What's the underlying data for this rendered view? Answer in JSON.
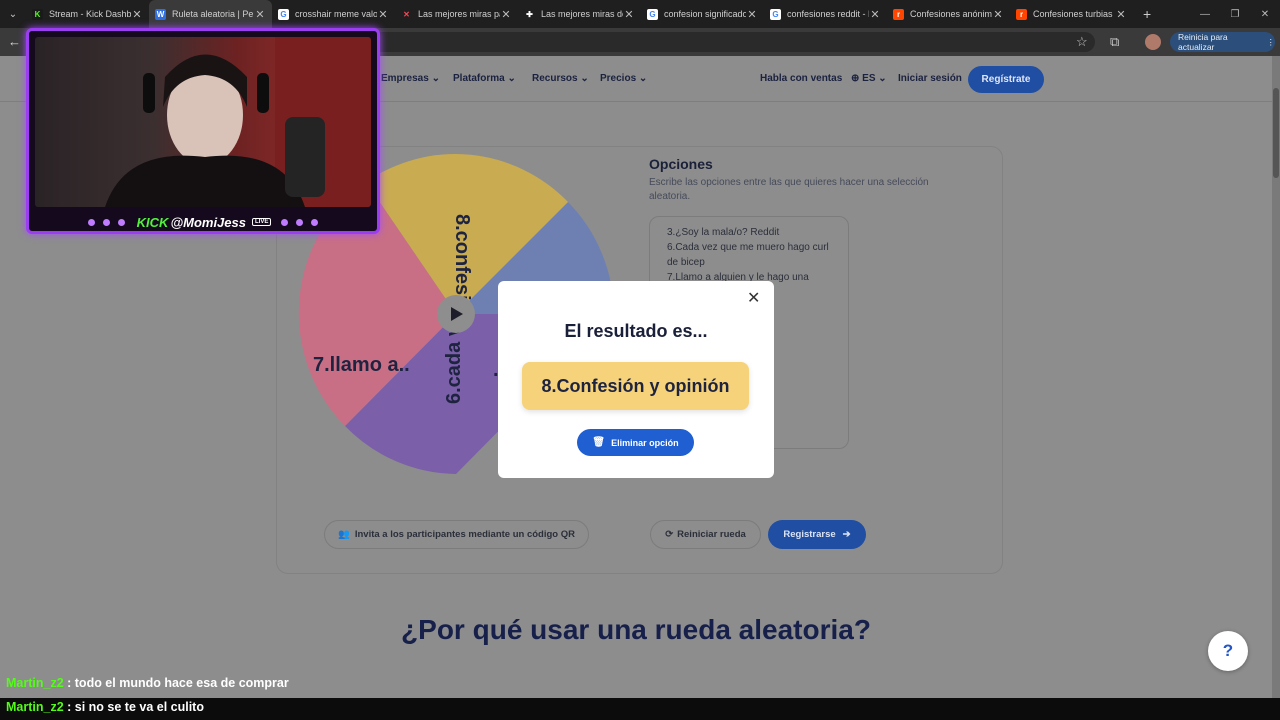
{
  "browser": {
    "tabs": [
      {
        "title": "Stream - Kick Dashbo",
        "fav": "K",
        "fav_bg": "#1a1a1a",
        "fav_color": "#53fc18"
      },
      {
        "title": "Ruleta aleatoria | Pers",
        "fav": "W",
        "fav_bg": "#2f6fe0",
        "fav_color": "#ffffff",
        "active": true
      },
      {
        "title": "crosshair meme valor",
        "fav": "G",
        "fav_bg": "#ffffff",
        "fav_color": "#4285f4"
      },
      {
        "title": "Las mejores miras pa",
        "fav": "✕",
        "fav_bg": "#1f1f1f",
        "fav_color": "#ff4655"
      },
      {
        "title": "Las mejores miras de",
        "fav": "✚",
        "fav_bg": "#1f1f1f",
        "fav_color": "#ffffff"
      },
      {
        "title": "confesion significado",
        "fav": "G",
        "fav_bg": "#ffffff",
        "fav_color": "#4285f4"
      },
      {
        "title": "confesiones reddit - E",
        "fav": "G",
        "fav_bg": "#ffffff",
        "fav_color": "#4285f4"
      },
      {
        "title": "Confesiones anónimas",
        "fav": "r",
        "fav_bg": "#ff4500",
        "fav_color": "#ffffff"
      },
      {
        "title": "Confesiones turbias",
        "fav": "r",
        "fav_bg": "#ff4500",
        "fav_color": "#ffffff"
      }
    ],
    "update_label": "Reinicia para actualizar"
  },
  "nav": {
    "items": [
      "Empresas",
      "Plataforma",
      "Recursos",
      "Precios"
    ],
    "sales": "Habla con ventas",
    "lang": "ES",
    "login": "Iniciar sesión",
    "signup": "Regístrate"
  },
  "wheel": {
    "segments": [
      {
        "label": "8.confesi...",
        "color": "#c9ab52"
      },
      {
        "label": "...",
        "color": "#6e80b2"
      },
      {
        "label": "6.cada ve..",
        "color": "#7b5fa9"
      },
      {
        "label": "7.llamo a..",
        "color": "#c86f86"
      }
    ]
  },
  "options": {
    "title": "Opciones",
    "description": "Escribe las opciones entre las que quieres hacer una selección aleatoria.",
    "lines": [
      "3.¿Soy la mala/o? Reddit",
      "6.Cada vez que me muero hago curl",
      "de bicep",
      "7.Llamo a alguien y le hago una"
    ]
  },
  "actions": {
    "qr": "Invita a los participantes mediante un código QR",
    "reset": "Reiniciar rueda",
    "register": "Registrarse"
  },
  "section_heading": "¿Por qué usar una rueda aleatoria?",
  "help": "?",
  "modal": {
    "title": "El resultado es...",
    "result": "8.Confesión y opinión",
    "delete": "Eliminar opción"
  },
  "stream": {
    "brand": "KICK",
    "handle": "@MomiJess",
    "badge": "LIVE"
  },
  "chat": [
    {
      "user": "Martin_z2",
      "message": "todo el mundo hace esa de comprar"
    },
    {
      "user": "Martin_z2",
      "message": "si no se te va el culito"
    }
  ]
}
